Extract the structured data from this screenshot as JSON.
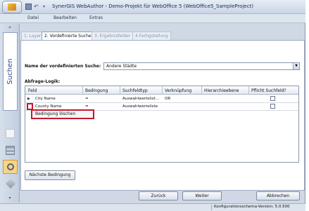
{
  "window": {
    "title": "SynerGIS WebAuthor - Demo-Projekt für WebOffice 5 (WebOffice5_SampleProject)"
  },
  "menu": {
    "items": [
      "Datei",
      "Bearbeiten",
      "Extras"
    ]
  },
  "sidebar": {
    "active_label": "Suchen",
    "collapse_symbol": "»",
    "bottom_symbol": "▾"
  },
  "wizard": {
    "tabs": [
      "1. Layer",
      "2. Vordefinierte Suche",
      "3. Ergebnisfelder",
      "4.Fertigstellung"
    ],
    "active_tab": 1
  },
  "form": {
    "name_label": "Name der vordefinierten Suche:",
    "name_value": "Andere Städte",
    "logic_label": "Abfrage-Logik:"
  },
  "grid": {
    "columns": [
      "Feld",
      "Bedingung",
      "Suchfeldtyp",
      "Verknüpfung",
      "Hierarchieebene",
      "Pflicht Suchfeld?"
    ],
    "rows": [
      {
        "indicator": "▶",
        "feld": "City Name",
        "bedingung": "=",
        "suchfeldtyp": "Auswahlwertelist...",
        "verknuepfung": "OR",
        "hierarchie": "",
        "pflicht": false
      },
      {
        "indicator": "",
        "feld": "County Name",
        "bedingung": "=",
        "suchfeldtyp": "Auswahlwerteliste",
        "verknuepfung": "",
        "hierarchie": "",
        "pflicht": false
      }
    ]
  },
  "context_menu": {
    "item": "Bedingung löschen"
  },
  "buttons": {
    "next_condition": "Nächste Bedingung",
    "back": "Zurück",
    "next": "Weiter",
    "cancel": "Abbrechen"
  },
  "status": {
    "text": "Konfigurationsschema-Version: 5.0.500"
  }
}
